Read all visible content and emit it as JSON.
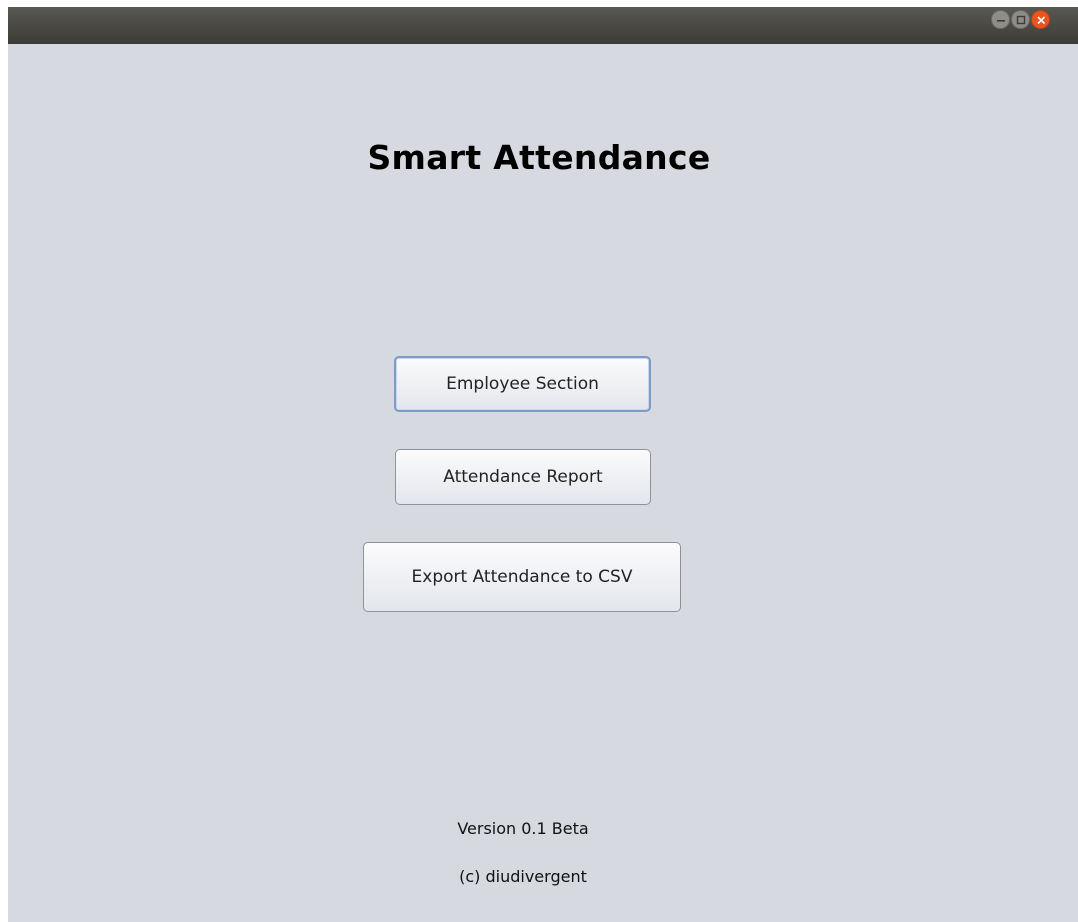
{
  "window": {
    "controls": {
      "minimize_icon": "minimize-icon",
      "maximize_icon": "maximize-icon",
      "close_icon": "close-icon"
    },
    "colors": {
      "background": "#d6d9e0",
      "titlebar": "#3c3b37",
      "close_button": "#e95420"
    }
  },
  "main": {
    "title": "Smart Attendance",
    "buttons": {
      "employee_section": "Employee Section",
      "attendance_report": "Attendance Report",
      "export_csv": "Export Attendance to CSV"
    }
  },
  "footer": {
    "version": "Version 0.1 Beta",
    "copyright": "(c) diudivergent"
  }
}
